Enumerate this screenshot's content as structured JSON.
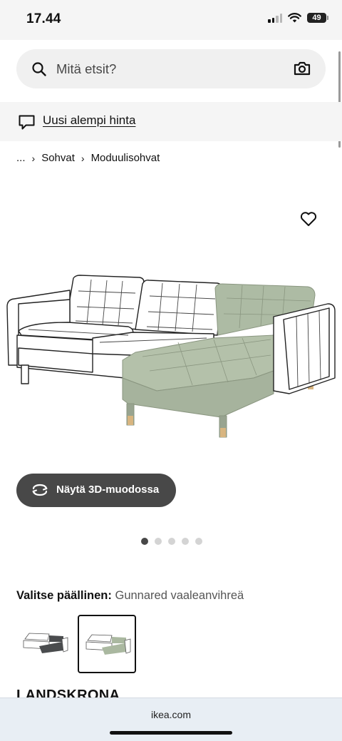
{
  "status_bar": {
    "time": "17.44",
    "battery": "49"
  },
  "search": {
    "placeholder": "Mitä etsit?"
  },
  "promo": {
    "link_text": "Uusi alempi hinta"
  },
  "breadcrumb": {
    "ellipsis": "...",
    "items": [
      "Sohvat",
      "Moduulisohvat"
    ]
  },
  "product": {
    "view_3d_label": "Näytä 3D-muodossa",
    "image_count": 5,
    "active_image": 1,
    "cover_label": "Valitse päällinen:",
    "cover_value": "Gunnared vaaleanvihreä",
    "swatches": [
      {
        "color": "dark-grey",
        "hex": "#4a4c4e",
        "selected": false
      },
      {
        "color": "light-green",
        "hex": "#aab8a0",
        "selected": true
      }
    ],
    "name": "LANDSKRONA",
    "fabric_color": "#adbba4"
  },
  "browser": {
    "url": "ikea.com"
  },
  "icons": [
    "search-icon",
    "camera-icon",
    "chat-icon",
    "chevron-right-icon",
    "heart-icon",
    "rotate-3d-icon"
  ]
}
